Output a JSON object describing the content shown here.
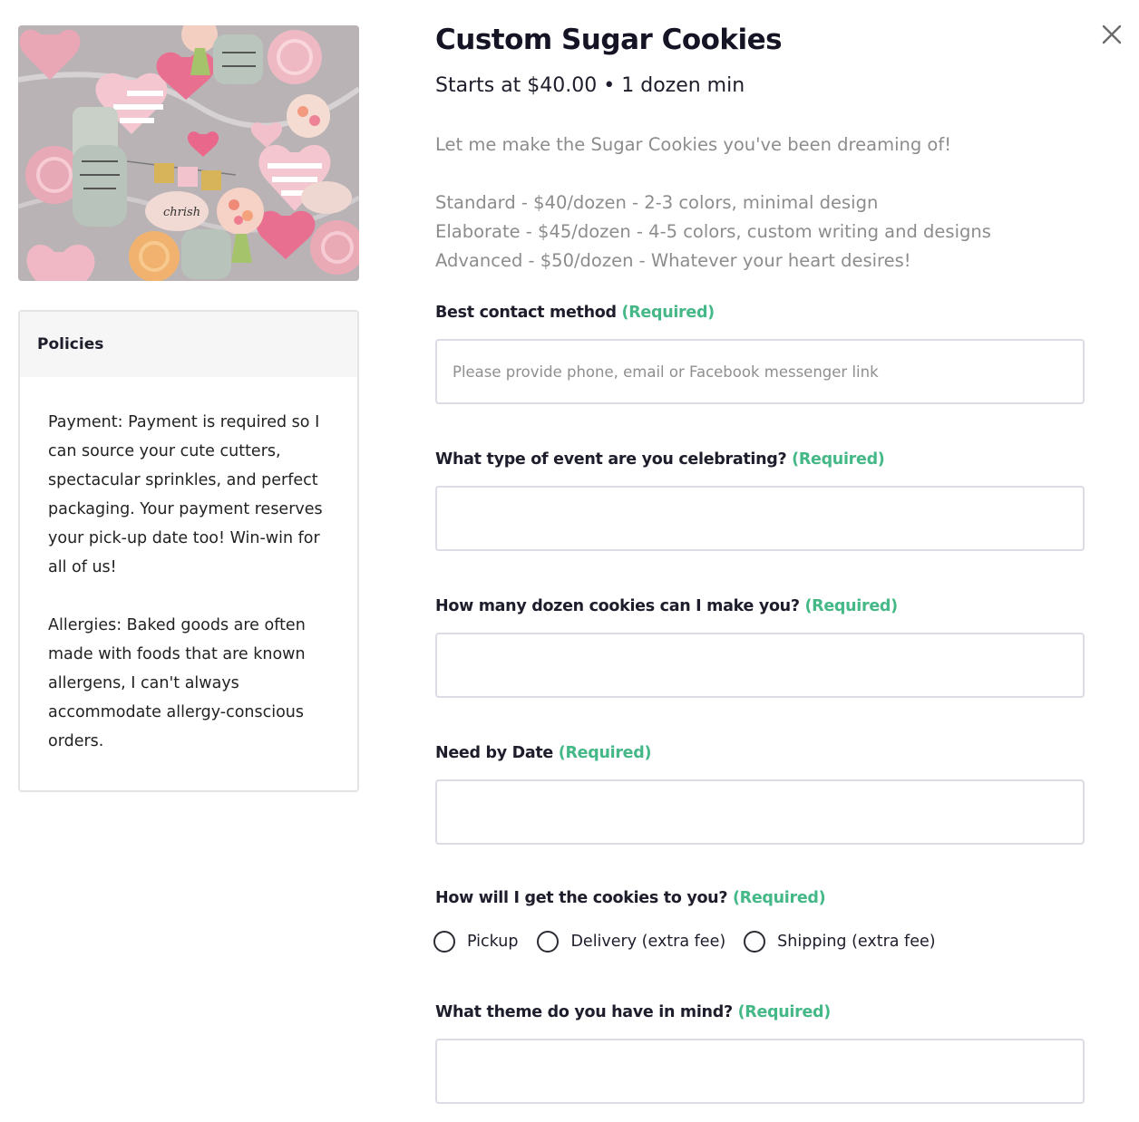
{
  "product": {
    "title": "Custom Sugar Cookies",
    "subtitle": "Starts at $40.00 • 1 dozen min",
    "description": {
      "intro": "Let me make the Sugar Cookies you've been dreaming of!",
      "tiers": [
        "Standard - $40/dozen - 2-3 colors, minimal design",
        "Elaborate - $45/dozen - 4-5 colors, custom writing and designs",
        "Advanced - $50/dozen - Whatever your heart desires!"
      ]
    }
  },
  "policies": {
    "heading": "Policies",
    "payment": "Payment: Payment is required so I can source your cute cutters, spectacular sprinkles, and perfect packaging. Your payment reserves your pick-up date too! Win-win for all of us!",
    "allergies": "Allergies: Baked goods are often made with foods that are known allergens, I can't always accommodate allergy-conscious orders."
  },
  "form": {
    "required_tag": "(Required)",
    "contact": {
      "label": "Best contact method",
      "placeholder": "Please provide phone, email or Facebook messenger link",
      "value": ""
    },
    "event": {
      "label": "What type of event are you celebrating?",
      "value": ""
    },
    "dozens": {
      "label": "How many dozen cookies can I make you?",
      "value": ""
    },
    "date": {
      "label": "Need by Date",
      "value": ""
    },
    "delivery": {
      "label": "How will I get the cookies to you?",
      "options": [
        "Pickup",
        "Delivery (extra fee)",
        "Shipping (extra fee)"
      ],
      "selected": null
    },
    "theme": {
      "label": "What theme do you have in mind?",
      "value": ""
    }
  },
  "colors": {
    "required": "#45b887",
    "description_text": "#8c8c8c",
    "input_border": "#dcdce4"
  },
  "icons": {
    "close": "close-icon"
  }
}
